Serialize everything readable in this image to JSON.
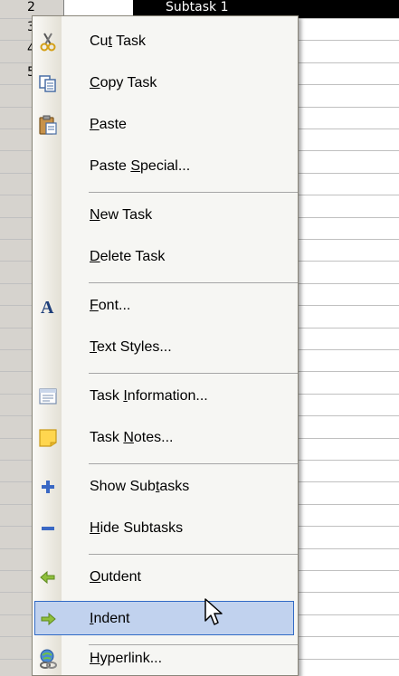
{
  "sheet": {
    "row_numbers": [
      "2",
      "3",
      "4",
      "5"
    ],
    "selected_cell_text": "Subtask 1"
  },
  "menu": {
    "items": [
      {
        "label_pre": "Cu",
        "label_u": "t",
        "label_post": " Task",
        "icon": "scissors-icon"
      },
      {
        "label_pre": "",
        "label_u": "C",
        "label_post": "opy Task",
        "icon": "copy-icon"
      },
      {
        "label_pre": "",
        "label_u": "P",
        "label_post": "aste",
        "icon": "paste-icon"
      },
      {
        "label_pre": "Paste ",
        "label_u": "S",
        "label_post": "pecial...",
        "icon": ""
      },
      {
        "label_pre": "",
        "label_u": "N",
        "label_post": "ew Task",
        "icon": ""
      },
      {
        "label_pre": "",
        "label_u": "D",
        "label_post": "elete Task",
        "icon": ""
      },
      {
        "label_pre": "",
        "label_u": "F",
        "label_post": "ont...",
        "icon": "font-icon"
      },
      {
        "label_pre": "",
        "label_u": "T",
        "label_post": "ext Styles...",
        "icon": ""
      },
      {
        "label_pre": "Task ",
        "label_u": "I",
        "label_post": "nformation...",
        "icon": "task-information-icon"
      },
      {
        "label_pre": "Task ",
        "label_u": "N",
        "label_post": "otes...",
        "icon": "task-notes-icon"
      },
      {
        "label_pre": "Show Sub",
        "label_u": "t",
        "label_post": "asks",
        "icon": "plus-icon"
      },
      {
        "label_pre": "",
        "label_u": "H",
        "label_post": "ide Subtasks",
        "icon": "minus-icon"
      },
      {
        "label_pre": "",
        "label_u": "O",
        "label_post": "utdent",
        "icon": "outdent-arrow-icon"
      },
      {
        "label_pre": "",
        "label_u": "I",
        "label_post": "ndent",
        "icon": "indent-arrow-icon"
      },
      {
        "label_pre": "",
        "label_u": "H",
        "label_post": "yperlink...",
        "icon": "hyperlink-icon"
      }
    ],
    "highlighted_item": "Indent",
    "colors": {
      "highlight_fill": "#c1d2ee",
      "highlight_border": "#316ac5",
      "menu_background": "#f6f6f3"
    }
  },
  "cursor": {
    "icon": "mouse-pointer-icon"
  }
}
